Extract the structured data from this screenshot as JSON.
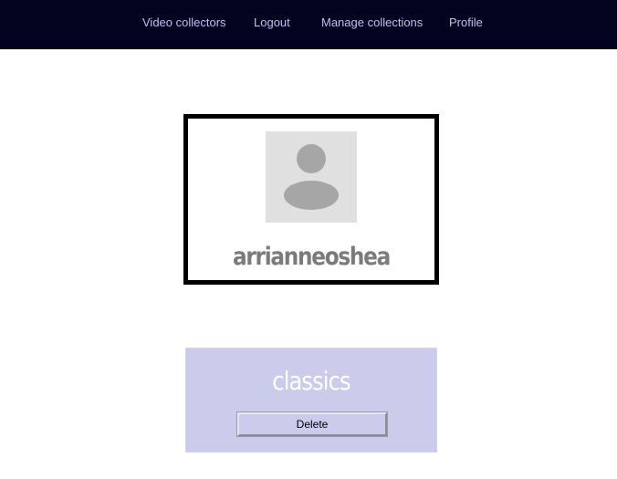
{
  "nav": {
    "items": [
      {
        "label": "Video collectors"
      },
      {
        "label": "Logout"
      },
      {
        "label": "Manage collections"
      },
      {
        "label": "Profile"
      }
    ]
  },
  "profile": {
    "username": "arrianneoshea",
    "avatar_icon": "user-placeholder-icon"
  },
  "collections": [
    {
      "name": "classics",
      "delete_label": "Delete"
    }
  ],
  "colors": {
    "navbar_bg": "#03021f",
    "nav_link": "#bfc0ee",
    "collection_bg": "#cbcbec",
    "username": "#7b7b7b"
  }
}
